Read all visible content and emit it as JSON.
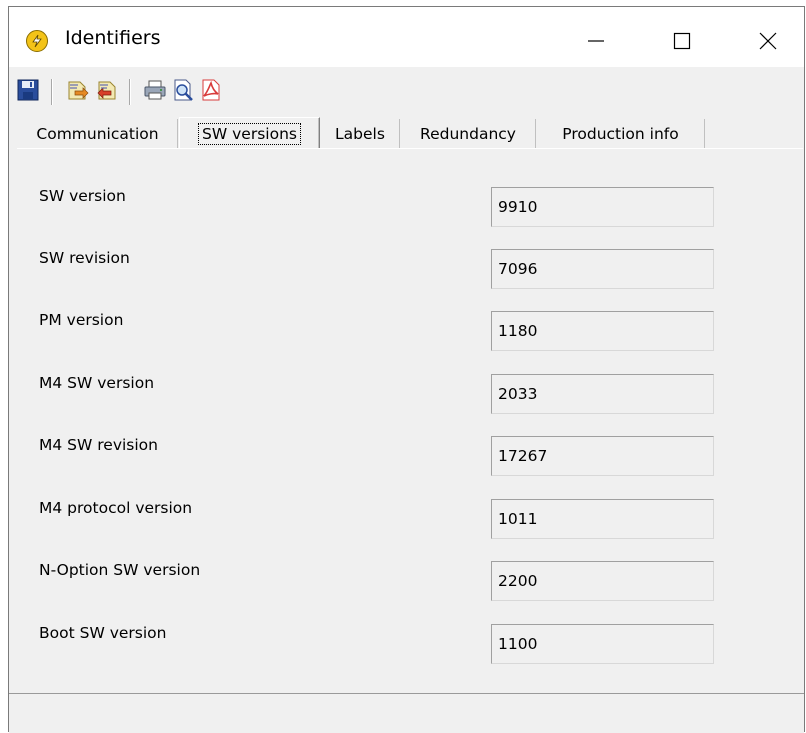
{
  "window": {
    "title": "Identifiers"
  },
  "toolbar": {
    "buttons": [
      {
        "name": "save-icon"
      },
      {
        "name": "import-icon"
      },
      {
        "name": "export-icon"
      },
      {
        "name": "print-icon"
      },
      {
        "name": "print-preview-icon"
      },
      {
        "name": "pdf-icon"
      }
    ]
  },
  "tabs": [
    {
      "label": "Communication",
      "active": false
    },
    {
      "label": "SW versions",
      "active": true
    },
    {
      "label": "Labels",
      "active": false
    },
    {
      "label": "Redundancy",
      "active": false
    },
    {
      "label": "Production info",
      "active": false
    }
  ],
  "fields": [
    {
      "label": "SW version",
      "value": "9910"
    },
    {
      "label": "SW revision",
      "value": "7096"
    },
    {
      "label": "PM version",
      "value": "1180"
    },
    {
      "label": "M4 SW version",
      "value": "2033"
    },
    {
      "label": "M4 SW revision",
      "value": "17267"
    },
    {
      "label": "M4 protocol version",
      "value": "1011"
    },
    {
      "label": "N-Option SW version",
      "value": "2200"
    },
    {
      "label": "Boot SW version",
      "value": "1100"
    }
  ],
  "colors": {
    "window_bg": "#f0f0f0",
    "titlebar_bg": "#ffffff",
    "app_icon": "#f3c318",
    "pdf_icon": "#d83b3b"
  }
}
